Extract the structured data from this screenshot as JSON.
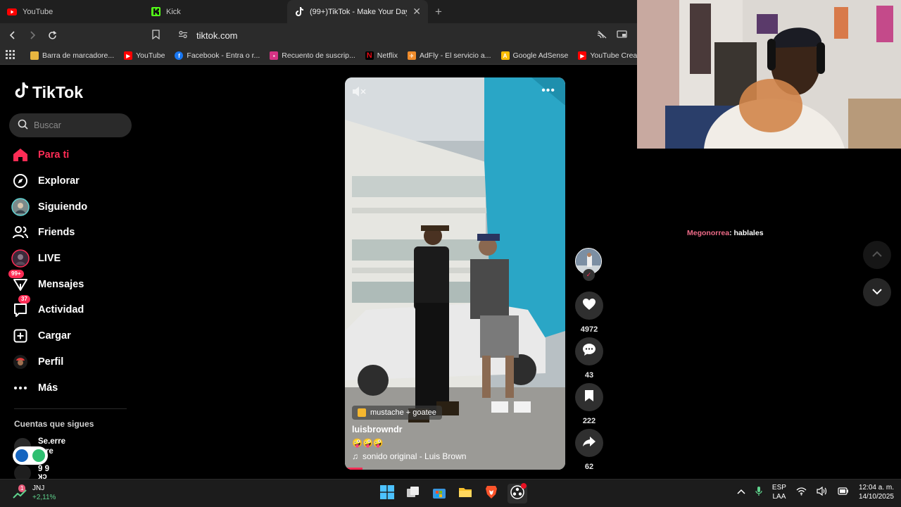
{
  "browser": {
    "tabs": [
      {
        "title": "YouTube",
        "icon": "youtube-icon"
      },
      {
        "title": "Kick",
        "icon": "kick-icon"
      },
      {
        "title": "(99+)TikTok - Make Your Day",
        "icon": "tiktok-icon",
        "active": true
      }
    ],
    "url": "tiktok.com",
    "bookmarks": [
      {
        "label": "Barra de marcadore...",
        "icon": "folder-icon"
      },
      {
        "label": "YouTube",
        "icon": "youtube-icon"
      },
      {
        "label": "Facebook - Entra o r...",
        "icon": "facebook-icon"
      },
      {
        "label": "Recuento de suscrip...",
        "icon": "counter-icon"
      },
      {
        "label": "Netflix",
        "icon": "netflix-icon"
      },
      {
        "label": "AdFly - El servicio a...",
        "icon": "adfly-icon"
      },
      {
        "label": "Google AdSense",
        "icon": "adsense-icon"
      },
      {
        "label": "YouTube Creator St...",
        "icon": "youtube-icon"
      }
    ]
  },
  "tiktok": {
    "logo": "TikTok",
    "search_placeholder": "Buscar",
    "nav": [
      {
        "label": "Para ti",
        "icon": "home-icon",
        "active": true
      },
      {
        "label": "Explorar",
        "icon": "compass-icon"
      },
      {
        "label": "Siguiendo",
        "icon": "following-avatar-icon"
      },
      {
        "label": "Friends",
        "icon": "friends-icon"
      },
      {
        "label": "LIVE",
        "icon": "live-icon"
      },
      {
        "label": "Mensajes",
        "icon": "messages-icon",
        "badge": "99+"
      },
      {
        "label": "Actividad",
        "icon": "activity-icon",
        "badge": "37"
      },
      {
        "label": "Cargar",
        "icon": "upload-icon"
      },
      {
        "label": "Perfil",
        "icon": "profile-icon"
      },
      {
        "label": "Más",
        "icon": "more-icon"
      }
    ],
    "following_title": "Cuentas que sigues",
    "following": [
      {
        "name": "Se.erre",
        "sub": "erre"
      },
      {
        "name": "9 9",
        "sub": "ʞɔ"
      }
    ],
    "video": {
      "effect": "mustache + goatee",
      "username": "luisbrowndr",
      "caption": "🤪🤪🤪",
      "sound": "sonido original - Luis Brown",
      "progress_fraction": 0.08
    },
    "actions": {
      "likes": "4972",
      "comments": "43",
      "saves": "222",
      "shares": "62"
    }
  },
  "chat": {
    "user": "Megonorrea",
    "message": ": hablales"
  },
  "taskbar": {
    "stock_name": "JNJ",
    "stock_change": "+2,11%",
    "notification_count": "1",
    "lang_top": "ESP",
    "lang_bottom": "LAA",
    "time": "12:04 a. m.",
    "date": "14/10/2025"
  }
}
